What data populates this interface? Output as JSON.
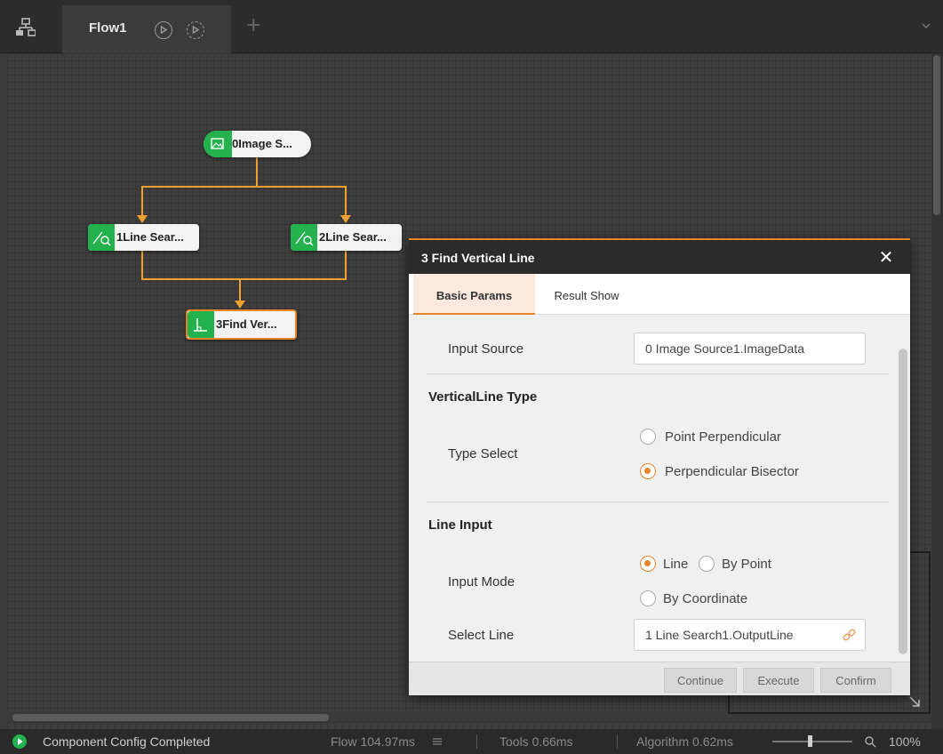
{
  "tabbar": {
    "flow_tab_label": "Flow1",
    "add_tab_label": "+"
  },
  "nodes": [
    {
      "label": "0Image S..."
    },
    {
      "label": "1Line Sear..."
    },
    {
      "label": "2Line Sear..."
    },
    {
      "label": "3Find Ver..."
    }
  ],
  "dialog": {
    "title": "3 Find Vertical Line",
    "close_label": "✕",
    "tabs": [
      "Basic Params",
      "Result Show"
    ],
    "input_source": {
      "label": "Input Source",
      "value": "0 Image Source1.ImageData"
    },
    "vertical_line_type": {
      "section_title": "VerticalLine Type",
      "type_select_label": "Type Select",
      "options": [
        "Point Perpendicular",
        "Perpendicular Bisector"
      ],
      "selected": "Perpendicular Bisector"
    },
    "line_input": {
      "section_title": "Line Input",
      "input_mode_label": "Input Mode",
      "mode_options": [
        "Line",
        "By Point",
        "By Coordinate"
      ],
      "selected_mode": "Line",
      "select_line_label": "Select Line",
      "select_line_value": "1 Line Search1.OutputLine"
    },
    "buttons": {
      "continue": "Continue",
      "execute": "Execute",
      "confirm": "Confirm"
    }
  },
  "statusbar": {
    "message": "Component Config Completed",
    "flow_time": "Flow  104.97ms",
    "tools_time": "Tools  0.66ms",
    "algorithm_time": "Algorithm  0.62ms",
    "zoom": "100%"
  },
  "colors": {
    "accent": "#e8842a",
    "node_green": "#22b14c",
    "connector": "#f0a030"
  }
}
